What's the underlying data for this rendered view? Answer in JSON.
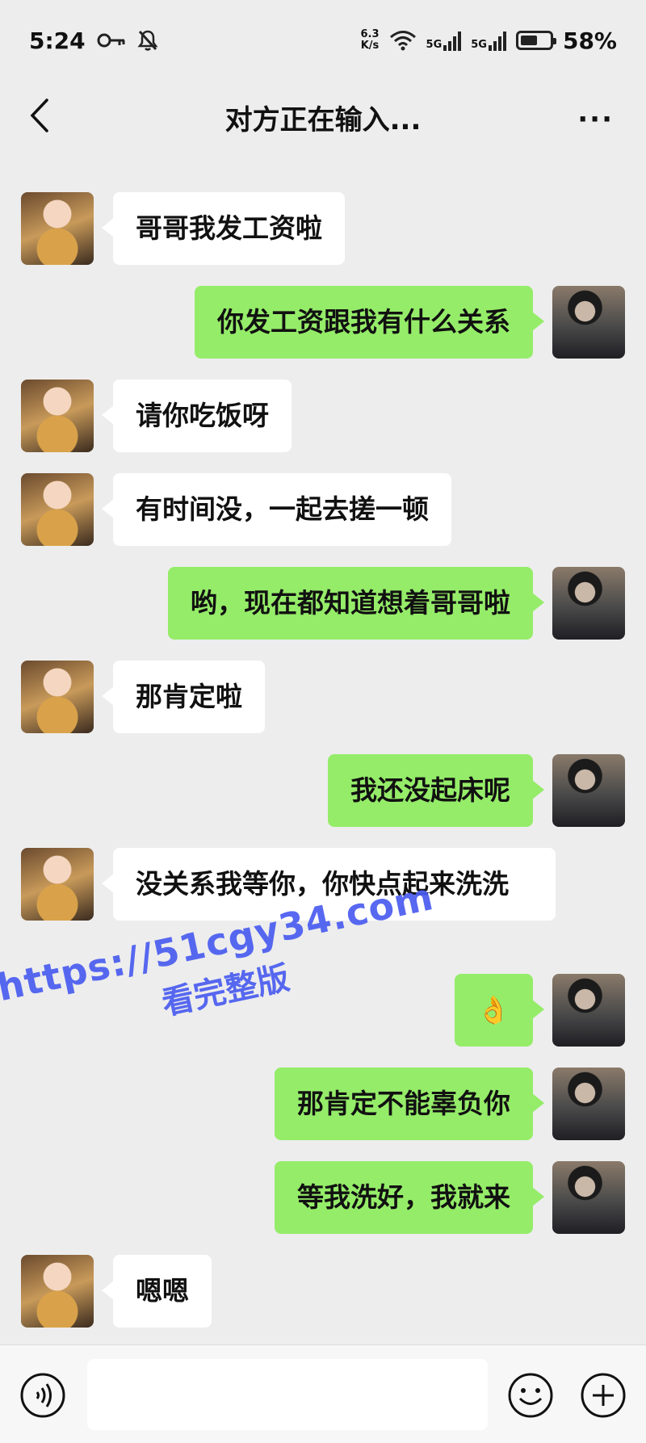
{
  "status_bar": {
    "time": "5:24",
    "net_speed_value": "6.3",
    "net_speed_unit": "K/s",
    "sim1": "5G",
    "sim2": "5G",
    "battery_percent": "58%",
    "battery_level": 0.58
  },
  "header": {
    "title": "对方正在输入...",
    "back_icon": "chevron-left-icon",
    "more_icon": "more-dots-icon"
  },
  "messages": [
    {
      "side": "left",
      "text": "哥哥我发工资啦"
    },
    {
      "side": "right",
      "text": "你发工资跟我有什么关系"
    },
    {
      "side": "left",
      "text": "请你吃饭呀"
    },
    {
      "side": "left",
      "text": "有时间没，一起去搓一顿"
    },
    {
      "side": "right",
      "text": "哟，现在都知道想着哥哥啦"
    },
    {
      "side": "left",
      "text": "那肯定啦"
    },
    {
      "side": "right",
      "text": "我还没起床呢"
    },
    {
      "side": "left",
      "text": "没关系我等你，你快点起来洗洗"
    },
    {
      "side": "right",
      "text": "👌"
    },
    {
      "side": "right",
      "text": "那肯定不能辜负你"
    },
    {
      "side": "right",
      "text": "等我洗好，我就来"
    },
    {
      "side": "left",
      "text": "嗯嗯"
    }
  ],
  "watermark": {
    "url": "https://51cgy34.com",
    "text": "看完整版"
  },
  "input_bar": {
    "voice_icon": "voice-icon",
    "emoji_icon": "emoji-icon",
    "plus_icon": "plus-icon",
    "text_value": ""
  }
}
